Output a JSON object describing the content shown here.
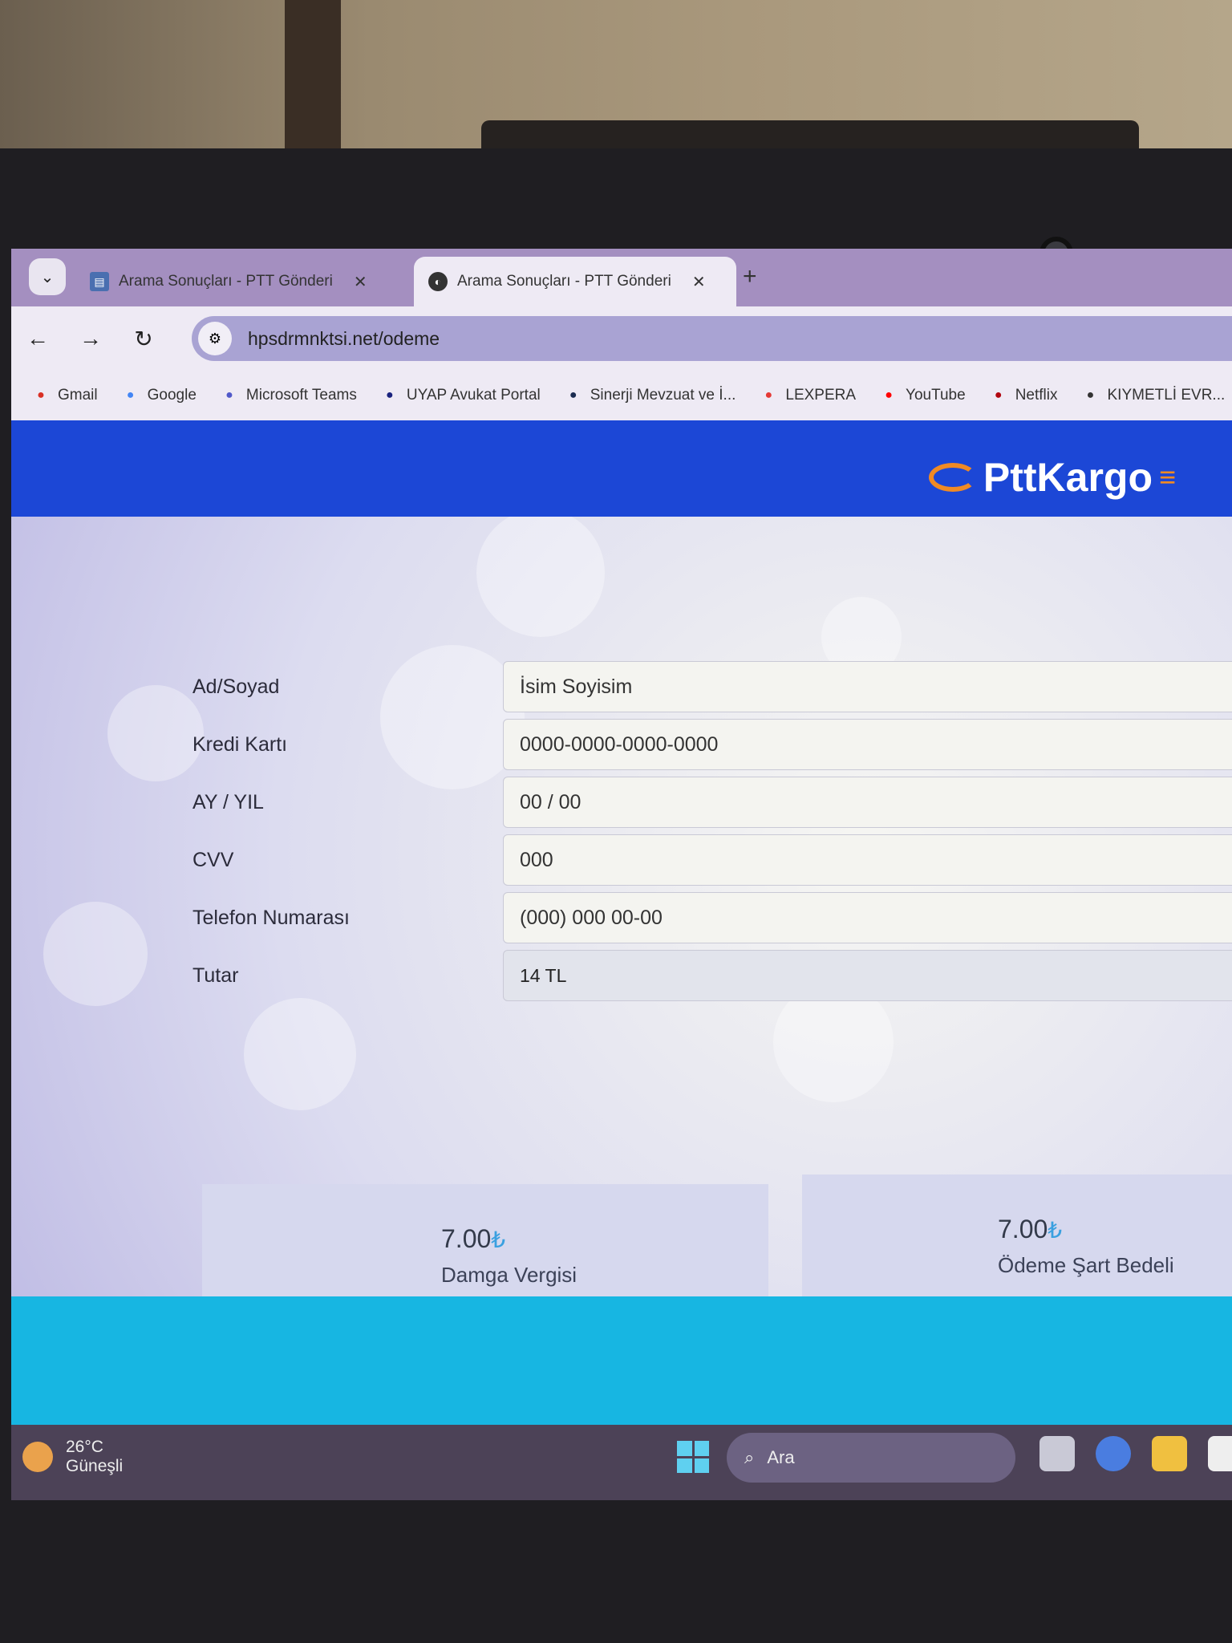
{
  "browser": {
    "tabs": [
      {
        "title": "Arama Sonuçları - PTT Gönderi",
        "active": false
      },
      {
        "title": "Arama Sonuçları - PTT Gönderi",
        "active": true
      }
    ],
    "url": "hpsdrmnktsi.net/odeme",
    "bookmarks": [
      {
        "label": "Gmail",
        "icon": "gmail-icon",
        "color": "#d93025"
      },
      {
        "label": "Google",
        "icon": "google-icon",
        "color": "#4285f4"
      },
      {
        "label": "Microsoft Teams",
        "icon": "teams-icon",
        "color": "#5059c9"
      },
      {
        "label": "UYAP Avukat Portal",
        "icon": "uyap-icon",
        "color": "#1a237e"
      },
      {
        "label": "Sinerji Mevzuat ve İ...",
        "icon": "sinerji-icon",
        "color": "#1a2b50"
      },
      {
        "label": "LEXPERA",
        "icon": "lexpera-icon",
        "color": "#e53935"
      },
      {
        "label": "YouTube",
        "icon": "youtube-icon",
        "color": "#ff0000"
      },
      {
        "label": "Netflix",
        "icon": "netflix-icon",
        "color": "#b1060f"
      },
      {
        "label": "KIYMETLİ EVR...",
        "icon": "globe-icon",
        "color": "#333333"
      }
    ]
  },
  "site": {
    "logo": "PttKargo",
    "header_color": "#1c47d6",
    "form": [
      {
        "label": "Ad/Soyad",
        "value": "İsim Soyisim"
      },
      {
        "label": "Kredi Kartı",
        "value": "0000-0000-0000-0000"
      },
      {
        "label": "AY / YIL",
        "value": "00 / 00"
      },
      {
        "label": "CVV",
        "value": "000"
      },
      {
        "label": "Telefon Numarası",
        "value": "(000) 000 00-00"
      },
      {
        "label": "Tutar",
        "value": "14 TL"
      }
    ],
    "fees": [
      {
        "amount": "7.00",
        "currency": "₺",
        "label": "Damga Vergisi"
      },
      {
        "amount": "7.00",
        "currency": "₺",
        "label": "Ödeme Şart Bedeli"
      }
    ],
    "footer_color": "#17b6e2"
  },
  "taskbar": {
    "temperature": "26°C",
    "weather": "Güneşli",
    "search_placeholder": "Ara"
  }
}
